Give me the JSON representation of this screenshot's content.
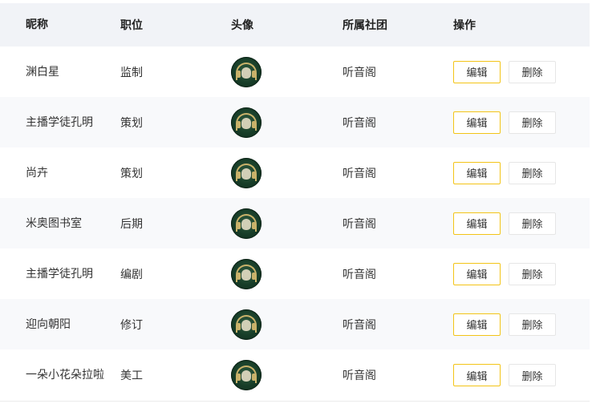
{
  "table": {
    "headers": {
      "nickname": "昵称",
      "position": "职位",
      "avatar": "头像",
      "club": "所属社团",
      "actions": "操作"
    },
    "edit_label": "编辑",
    "delete_label": "删除",
    "rows": [
      {
        "nickname": "渊白星",
        "position": "监制",
        "club": "听音阁"
      },
      {
        "nickname": "主播学徒孔明",
        "position": "策划",
        "club": "听音阁"
      },
      {
        "nickname": "尚卉",
        "position": "策划",
        "club": "听音阁"
      },
      {
        "nickname": "米奥图书室",
        "position": "后期",
        "club": "听音阁"
      },
      {
        "nickname": "主播学徒孔明",
        "position": "编剧",
        "club": "听音阁"
      },
      {
        "nickname": "迎向朝阳",
        "position": "修订",
        "club": "听音阁"
      },
      {
        "nickname": "一朵小花朵拉啦",
        "position": "美工",
        "club": "听音阁"
      }
    ]
  },
  "colors": {
    "header_bg": "#f1f3f7",
    "edit_border": "#f3c417",
    "avatar_green": "#173d28"
  },
  "icons": {
    "avatar": "club-logo-avatar"
  }
}
